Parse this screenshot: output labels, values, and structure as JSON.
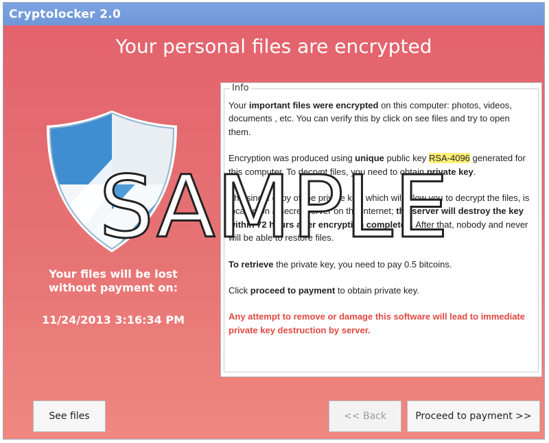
{
  "window": {
    "title": "Cryptolocker 2.0"
  },
  "main": {
    "headline": "Your personal files are encrypted",
    "shield_icon": "shield-icon",
    "lost_line1": "Your files will be lost",
    "lost_line2": "without payment on:",
    "deadline": "11/24/2013 3:16:34 PM"
  },
  "info": {
    "legend": "Info",
    "p1_a": "Your ",
    "p1_b": "important files were encrypted",
    "p1_c": " on this computer: photos, videos, documents , etc. You can verify this by click on see files and try to open them.",
    "p2_a": "Encryption was produced using ",
    "p2_b": "unique",
    "p2_c": " public key ",
    "p2_key": "RSA-4096",
    "p2_d": " generated for this computer. To decrypt files, you need to obtain ",
    "p2_e": "private key",
    "p2_f": ".",
    "p3_a": "The single copy of the private key, which will allow you to decrypt the files, is located on a secret server on the Internet; ",
    "p3_b": "the server will destroy the key within 72 hours after encryption completed",
    "p3_c": ". After that, nobody and never will be able to restore files.",
    "p4_a": "To retrieve",
    "p4_b": " the private key, you need to pay 0.5 bitcoins.",
    "p5_a": "Click ",
    "p5_b": "proceed to payment",
    "p5_c": " to obtain private key.",
    "warning": "Any attempt to remove or damage this software will lead to immediate private key destruction by server."
  },
  "buttons": {
    "see_files": "See files",
    "back": "<< Back",
    "proceed": "Proceed to payment >>"
  },
  "watermark": "SAMPLE",
  "colors": {
    "background": "#e3636d",
    "titlebar": "#7da3e0",
    "warning": "#e1483f",
    "highlight": "#fff176"
  }
}
